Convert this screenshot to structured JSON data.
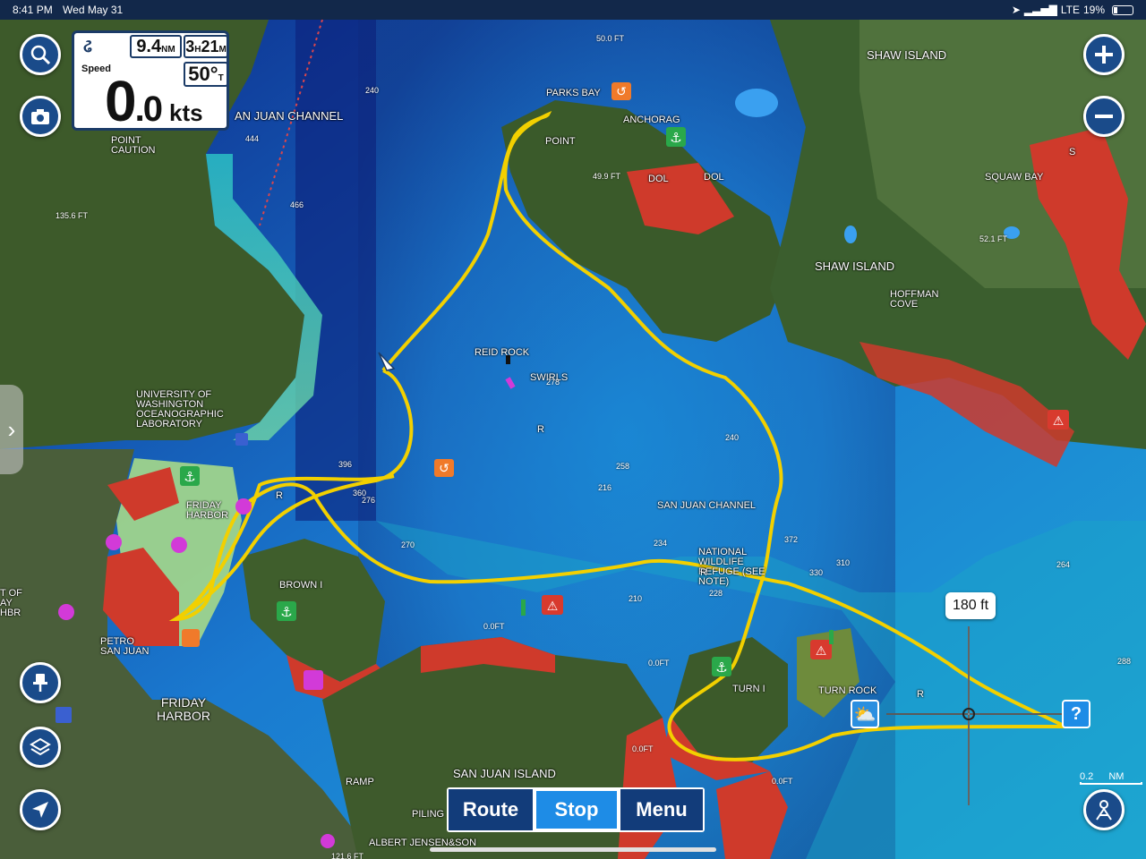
{
  "status": {
    "time": "8:41 PM",
    "date": "Wed May 31",
    "network": "LTE",
    "battery": "19%",
    "battery_level": 0.19
  },
  "instrument": {
    "distance_value": "9.4",
    "distance_unit": "NM",
    "time_hours": "3",
    "time_h": "H",
    "time_minutes": "21",
    "time_m": "M",
    "speed_label": "Speed",
    "speed_whole": "0",
    "speed_decimal": ".0",
    "speed_unit": "kts",
    "heading": "50°",
    "heading_ref": "T"
  },
  "map_labels": {
    "san_juan_channel_n": "AN JUAN CHANNEL",
    "shaw_island_n": "SHAW ISLAND",
    "shaw_island": "SHAW ISLAND",
    "parks_bay": "PARKS BAY",
    "anchorage": "ANCHORAG",
    "point": "POINT",
    "point_caution": "POINT CAUTION",
    "squaw_bay": "SQUAW BAY",
    "hoffman_cove": "HOFFMAN COVE",
    "university": "UNIVERSITY OF WASHINGTON OCEANOGRAPHIC LABORATORY",
    "friday_harbor_small": "FRIDAY HARBOR",
    "friday_harbor_town": "FRIDAY HARBOR",
    "brown": "BROWN I",
    "petro": "PETRO SAN JUAN",
    "swirls": "SWIRLS",
    "reid_rock": "REID ROCK",
    "san_juan_channel": "SAN JUAN CHANNEL",
    "national_refuge": "NATIONAL WILDLIFE REFUGE (SEE NOTE)",
    "turn_i": "TURN I",
    "turn_rock": "TURN ROCK",
    "san_juan_island": "SAN JUAN ISLAND",
    "piling": "PILING",
    "albert_jensen": "ALBERT JENSEN&SON",
    "ramp": "RAMP",
    "dol_1": "DOL",
    "dol_2": "DOL",
    "harbor_left": "T OF AY HBR",
    "s": "S",
    "r1": "R",
    "r2": "R",
    "r3": "R",
    "r4": "R"
  },
  "depth_labels": {
    "d1": "135.6 FT",
    "d2": "49.9 FT",
    "d3": "52.1 FT",
    "d4": "0.0FT",
    "d5": "0.0FT",
    "d6": "0.0FT",
    "d7": "0.0FT",
    "d8": "121.6 FT",
    "d9": "278",
    "d10": "258",
    "d11": "216",
    "d12": "234",
    "d13": "270",
    "d14": "276",
    "d15": "360",
    "d16": "372",
    "d17": "330",
    "d18": "310",
    "d19": "288",
    "d20": "264",
    "d21": "228",
    "d22": "210",
    "d23": "240",
    "d24": "396",
    "d25": "444",
    "d26": "466",
    "d27": "240",
    "d28": "50.0 FT"
  },
  "scale": {
    "bubble": "180 ft",
    "info": "?",
    "bar_value": "0.2",
    "bar_unit": "NM"
  },
  "bottom_bar": {
    "route": "Route",
    "stop": "Stop",
    "menu": "Menu"
  },
  "icons": {
    "search": "search-icon",
    "camera": "camera-icon",
    "zoom_in": "plus-icon",
    "zoom_out": "minus-icon",
    "pin": "pin-icon",
    "layers": "layers-icon",
    "locate": "location-arrow-icon",
    "account": "account-icon",
    "weather": "weather-icon"
  },
  "colors": {
    "track": "#f2d000",
    "button_bg": "#1a4b8a",
    "active_tab": "#1e8ce6",
    "tab": "#123c7a"
  }
}
